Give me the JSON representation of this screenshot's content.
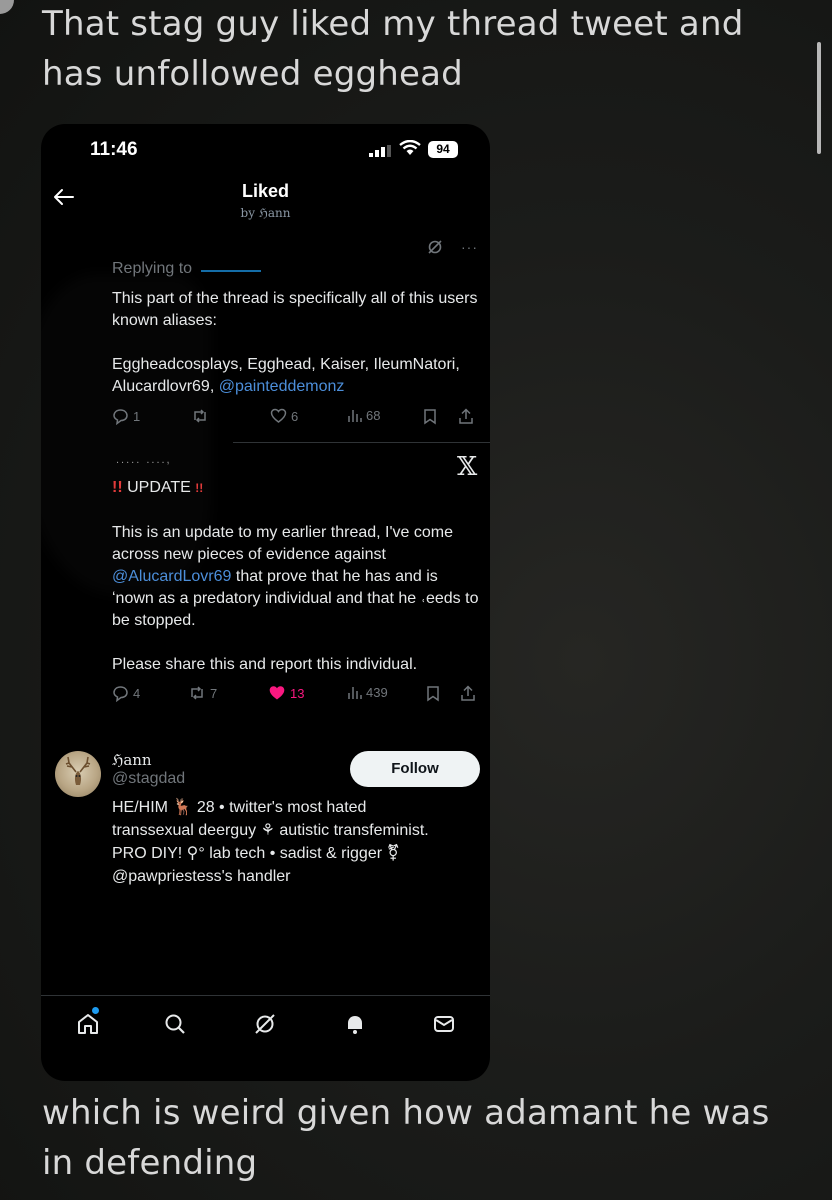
{
  "caption": {
    "top": "That stag guy liked my thread tweet and has unfollowed egghead",
    "bottom": "which is weird given how adamant he was in defending"
  },
  "status_bar": {
    "time": "11:46",
    "battery": "94"
  },
  "header": {
    "title": "Liked",
    "subtitle": "by ℌann"
  },
  "post1": {
    "replying_to": "Replying to",
    "text_1": "This part of the thread is specifically all of this users known aliases:",
    "text_2": "Eggheadcosplays, Egghead, Kaiser, IleumNatori, Alucardlovr69,",
    "mention": "@painteddemonz",
    "replies": "1",
    "likes": "6",
    "views": "68"
  },
  "post2": {
    "handle_snippet": "..... ....,",
    "update_label": "UPDATE",
    "text_1": "This is an update to my earlier thread, I've come across new pieces of evidence against",
    "mention": "@AlucardLovr69",
    "text_2": "that prove that he has and is ",
    "text_3": "ʻnown as a predatory individual and that he ˓eeds to be stopped.",
    "text_4": "Please share this and report this individual.",
    "replies": "4",
    "reposts": "7",
    "likes": "13",
    "views": "439",
    "x_logo": "𝕏"
  },
  "profile": {
    "name": "ℌann",
    "handle": "@stagdad",
    "follow_label": "Follow",
    "bio_1": "HE/HIM 🦌 28 • twitter's most hated",
    "bio_2": "transsexual deerguy ⚘ autistic transfeminist.",
    "bio_3": "PRO DIY! ⚲° lab tech • sadist & rigger ⚧",
    "bio_4": "@pawpriestess's handler"
  },
  "colors": {
    "link": "#4c8ed9",
    "like": "#f91880",
    "accent": "#1d9bf0"
  },
  "icons": [
    "back-arrow-icon",
    "signal-icon",
    "wifi-icon",
    "battery-icon",
    "grok-icon",
    "more-icon",
    "reply-icon",
    "repost-icon",
    "like-icon",
    "views-icon",
    "bookmark-icon",
    "share-icon",
    "x-logo-icon",
    "home-icon",
    "search-icon",
    "grok-tab-icon",
    "notifications-icon",
    "messages-icon"
  ]
}
